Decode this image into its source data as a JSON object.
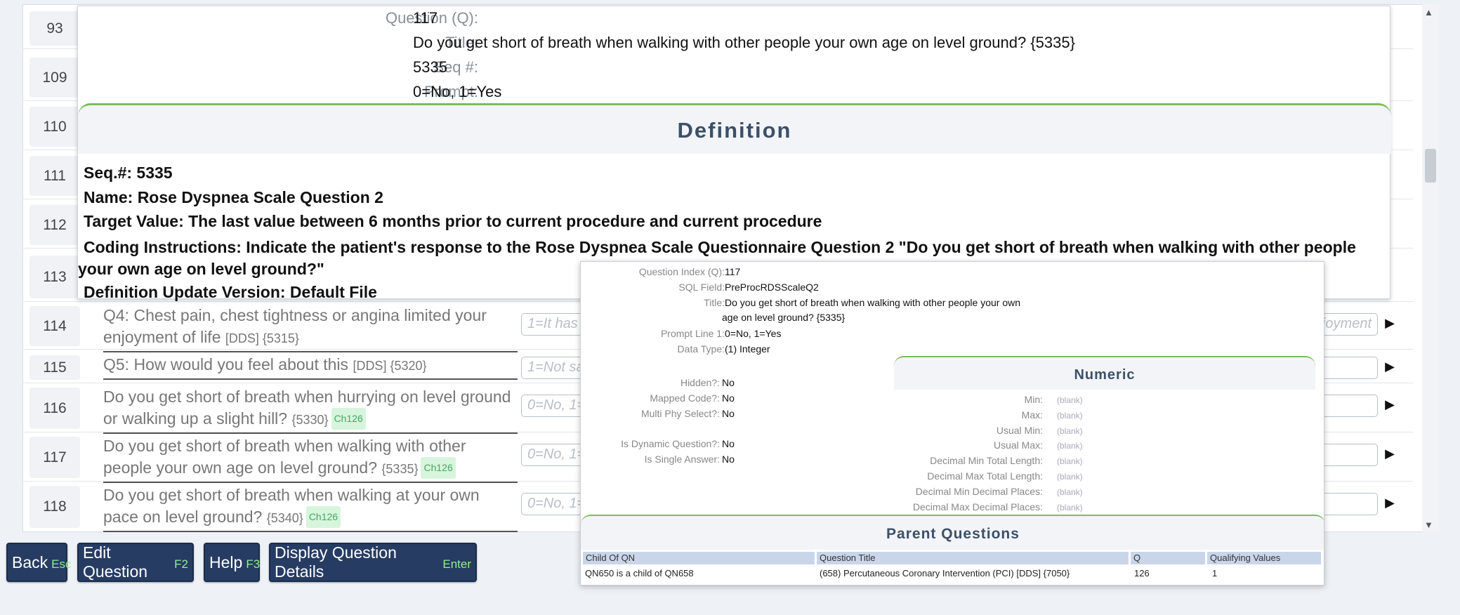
{
  "rows": [
    {
      "num": "93"
    },
    {
      "num": "109"
    },
    {
      "num": "110"
    },
    {
      "num": "111"
    },
    {
      "num": "112"
    },
    {
      "num": "113"
    },
    {
      "num": "114",
      "text": "Q4: Chest pain, chest tightness or angina limited your enjoyment of life",
      "tag": "[DDS] {5315}",
      "answer": "1=It has",
      "answer_right": "enjoyment"
    },
    {
      "num": "115",
      "text": "Q5: How would you feel about this",
      "tag": "[DDS] {5320}",
      "answer": "1=Not sa"
    },
    {
      "num": "116",
      "text": "Do you get short of breath when hurrying on level ground or walking up a slight hill?",
      "tag": "{5330}",
      "ch": "Ch126",
      "answer": "0=No, 1="
    },
    {
      "num": "117",
      "text": "Do you get short of breath when walking with other people your own age on level ground?",
      "tag": "{5335}",
      "ch": "Ch126",
      "answer": "0=No, 1="
    },
    {
      "num": "118",
      "text": "Do you get short of breath when walking at your own pace on level ground?",
      "tag": "{5340}",
      "ch": "Ch126",
      "answer": "0=No, 1="
    }
  ],
  "buttons": {
    "back": {
      "label": "Back",
      "key": "Esc"
    },
    "edit": {
      "label": "Edit Question",
      "key": "F2"
    },
    "help": {
      "label": "Help",
      "key": "F3"
    },
    "display": {
      "label": "Display Question Details",
      "key": "Enter"
    }
  },
  "popup": {
    "question_label": "Question (Q):",
    "question_value": "117",
    "title_label": "Title:",
    "title_value": "Do you get short of breath when walking with other people your own age on level ground? {5335}",
    "seq_label": "Seq #:",
    "seq_value": "5335",
    "prompt_label": "Prompt:",
    "prompt_value": "0=No, 1=Yes",
    "definition_header": "Definition",
    "def_seq": "Seq.#: 5335",
    "def_name": "Name: Rose Dyspnea Scale Question 2",
    "def_target": "Target Value: The last value between 6 months prior to current procedure and current procedure",
    "def_coding": "Coding Instructions: Indicate the patient's response to the Rose Dyspnea Scale Questionnaire Question 2 \"Do you get short of breath when walking with other people your own age on level ground?\"",
    "def_update": "Definition Update Version: Default File"
  },
  "details": {
    "qi_label": "Question Index (Q):",
    "qi_value": "117",
    "sql_label": "SQL Field:",
    "sql_value": "PreProcRDSScaleQ2",
    "title_label": "Title:",
    "title_value_1": "Do you get short of breath when walking with other people your own",
    "title_value_2": "age on level ground? {5335}",
    "prompt_label": "Prompt Line 1:",
    "prompt_value": "0=No, 1=Yes",
    "dtype_label": "Data Type:",
    "dtype_value": "(1) Integer",
    "hidden_label": "Hidden?:",
    "hidden_value": "No",
    "mapped_label": "Mapped Code?:",
    "mapped_value": "No",
    "multi_label": "Multi Phy Select?:",
    "multi_value": "No",
    "dynamic_label": "Is Dynamic Question?:",
    "dynamic_value": "No",
    "single_label": "Is Single Answer:",
    "single_value": "No",
    "numeric_header": "Numeric",
    "numeric": [
      {
        "label": "Min:",
        "value": "(blank)"
      },
      {
        "label": "Max:",
        "value": "(blank)"
      },
      {
        "label": "Usual Min:",
        "value": "(blank)"
      },
      {
        "label": "Usual Max:",
        "value": "(blank)"
      },
      {
        "label": "Decimal Min Total Length:",
        "value": "(blank)"
      },
      {
        "label": "Decimal Max Total Length:",
        "value": "(blank)"
      },
      {
        "label": "Decimal Min Decimal Places:",
        "value": "(blank)"
      },
      {
        "label": "Decimal Max Decimal Places:",
        "value": "(blank)"
      }
    ],
    "parent_header": "Parent Questions",
    "parent_columns": [
      "Child Of QN",
      "Question Title",
      "Q",
      "Qualifying Values"
    ],
    "parent_row": [
      "QN650 is a child of QN658",
      "(658) Percutaneous Coronary Intervention (PCI) [DDS] {7050}",
      "126",
      "1"
    ]
  },
  "colors": {
    "accent_green": "#7cbd5a",
    "button_navy": "#263c63",
    "header_text": "#3d5067"
  }
}
